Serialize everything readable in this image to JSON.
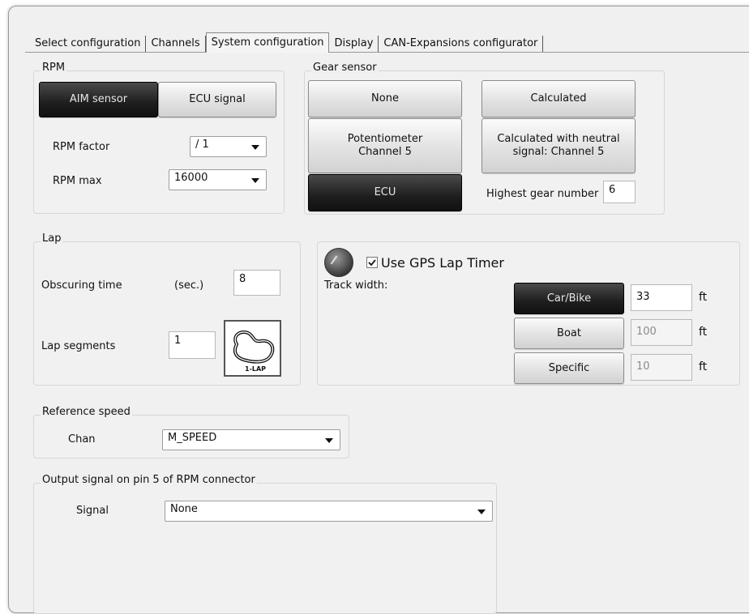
{
  "tabs": [
    {
      "label": "Select configuration"
    },
    {
      "label": "Channels"
    },
    {
      "label": "System configuration"
    },
    {
      "label": "Display"
    },
    {
      "label": "CAN-Expansions configurator"
    }
  ],
  "rpm": {
    "title": "RPM",
    "aim_sensor": "AIM sensor",
    "ecu_signal": "ECU signal",
    "factor_label": "RPM factor",
    "factor_value": "/ 1",
    "max_label": "RPM max",
    "max_value": "16000"
  },
  "gear": {
    "title": "Gear sensor",
    "none": "None",
    "calculated": "Calculated",
    "potentiometer": "Potentiometer\nChannel 5",
    "calculated_neutral": "Calculated with neutral\nsignal: Channel 5",
    "ecu": "ECU",
    "highest_label": "Highest gear number",
    "highest_value": "6"
  },
  "lap": {
    "title": "Lap",
    "obscuring_label": "Obscuring time",
    "obscuring_unit": "(sec.)",
    "obscuring_value": "8",
    "segments_label": "Lap segments",
    "segments_value": "1",
    "lap_icon_text": "1-LAP"
  },
  "gps": {
    "use_label": "Use GPS Lap Timer",
    "checked": true,
    "track_width_label": "Track width:",
    "rows": [
      {
        "button": "Car/Bike",
        "value": "33",
        "unit": "ft"
      },
      {
        "button": "Boat",
        "value": "100",
        "unit": "ft"
      },
      {
        "button": "Specific",
        "value": "10",
        "unit": "ft"
      }
    ]
  },
  "reference_speed": {
    "title": "Reference speed",
    "chan_label": "Chan",
    "chan_value": "M_SPEED"
  },
  "output_signal": {
    "title": "Output signal on pin 5 of RPM connector",
    "signal_label": "Signal",
    "signal_value": "None"
  },
  "colors": {
    "selected_button": "#1e1e1e",
    "panel_background": "#f0f0f0"
  }
}
